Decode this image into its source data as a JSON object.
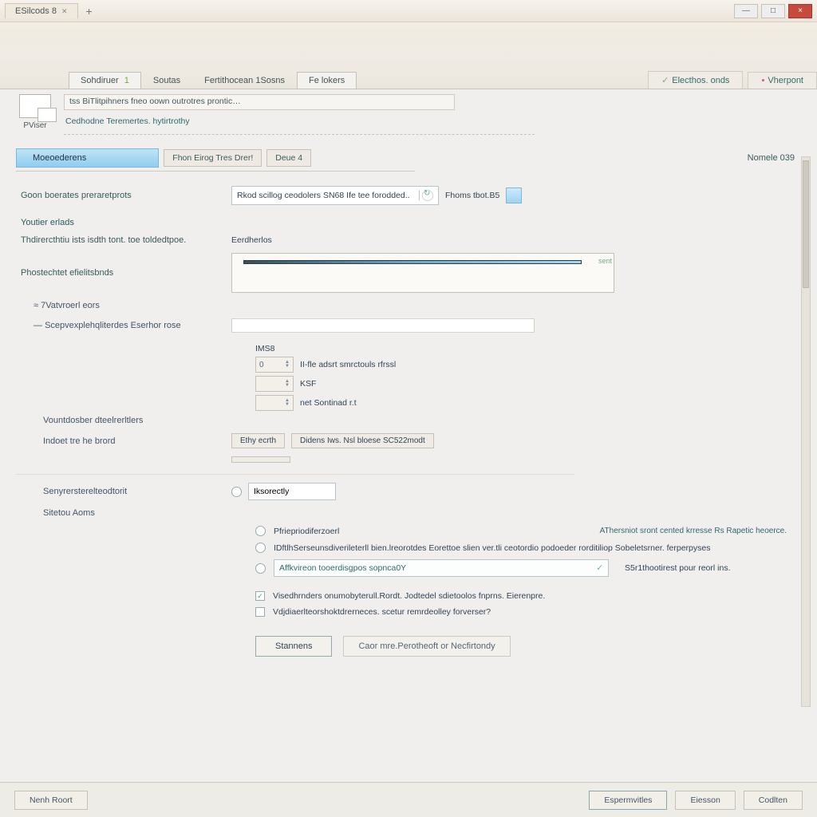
{
  "window": {
    "tab_title": "ESilcods 8",
    "min": "—",
    "max": "□",
    "close": "×"
  },
  "ribbon_tabs": {
    "t1": "Sohdiruer",
    "t1_badge": "1",
    "t2": "Soutas",
    "t3": "Fertithocean 1Sosns",
    "t4": "Fe lokers",
    "r1": "Electhos. onds",
    "r2": "Vherpont"
  },
  "subheader": {
    "device_label": "PViser",
    "path": "tss BiTlitpihners fneo oown  outrotres prontic…",
    "subpath": "Cedhodne Teremertes. hytirtrothy"
  },
  "section": {
    "active_tab": "Moeoederens",
    "btn1": "Fhon Eirog Tres Drer!",
    "btn2": "Deue 4",
    "right_label": "Nomele 039"
  },
  "form": {
    "row1_label": "Goon boerates preraretprots",
    "row1_combo": "Rkod scillog ceodolers SN68 Ife tee forodded..",
    "row1_aux": "Fhoms tbot.B5",
    "row2_label": "Youtier erlads",
    "row3_label": "Thdirercthtiu ists isdth tont. toe toldedtpoe.",
    "row3_heading": "Eerdherlos",
    "row4_label": "Phostechtet efielitsbnds",
    "row5_label": "7Vatvroerl eors",
    "row6_label": "Scepvexplehqliterdes Eserhor rose",
    "group_title": "IMS8",
    "group_item1": "II-fle adsrt smrctouls rfrssl",
    "group_item2": "KSF",
    "group_item3": "net Sontinad  r.t",
    "row7_label": "Vountdosber dteelrerltlers",
    "row8_label": "Indoet tre he brord",
    "row8_chip1": "Ethy   ecrth",
    "row8_chip2": "Didens Iws. Nsl bloese SC522modt",
    "row9_label": "Senyrersterelteodtorit",
    "row9_value": "Iksorectly",
    "row10_label": "Sitetou Aoms",
    "opt1": "Pfriepriodiferzoerl",
    "opt1_note": "AThersniot sront cented krresse Rs Rapetic heoerce.",
    "opt2": "IDftlhSerseunsdiverileterll bien.lreorotdes Eorettoe slien ver.tli ceotordio podoeder rorditiliop Sobeletsrner. ferperpyses",
    "opt3_value": "Affkvireon tooerdisgpos sopnca0Y",
    "opt3_note": "S5r1thootirest pour reorl ins.",
    "chk1": "Visedhrnders onumobyterull.Rordt. Jodtedel sdietoolos fnprns. Eierenpre.",
    "chk2": "Vdjdiaerlteorshoktdrerneces. scetur remrdeolley forverser?"
  },
  "buttons": {
    "primary": "Stannens",
    "secondary": "Caor mre.Perotheoft or Necfirtondy"
  },
  "footer": {
    "left": "Nenh Roort",
    "b1": "Espermvitles",
    "b2": "Eiesson",
    "b3": "Codlten"
  }
}
